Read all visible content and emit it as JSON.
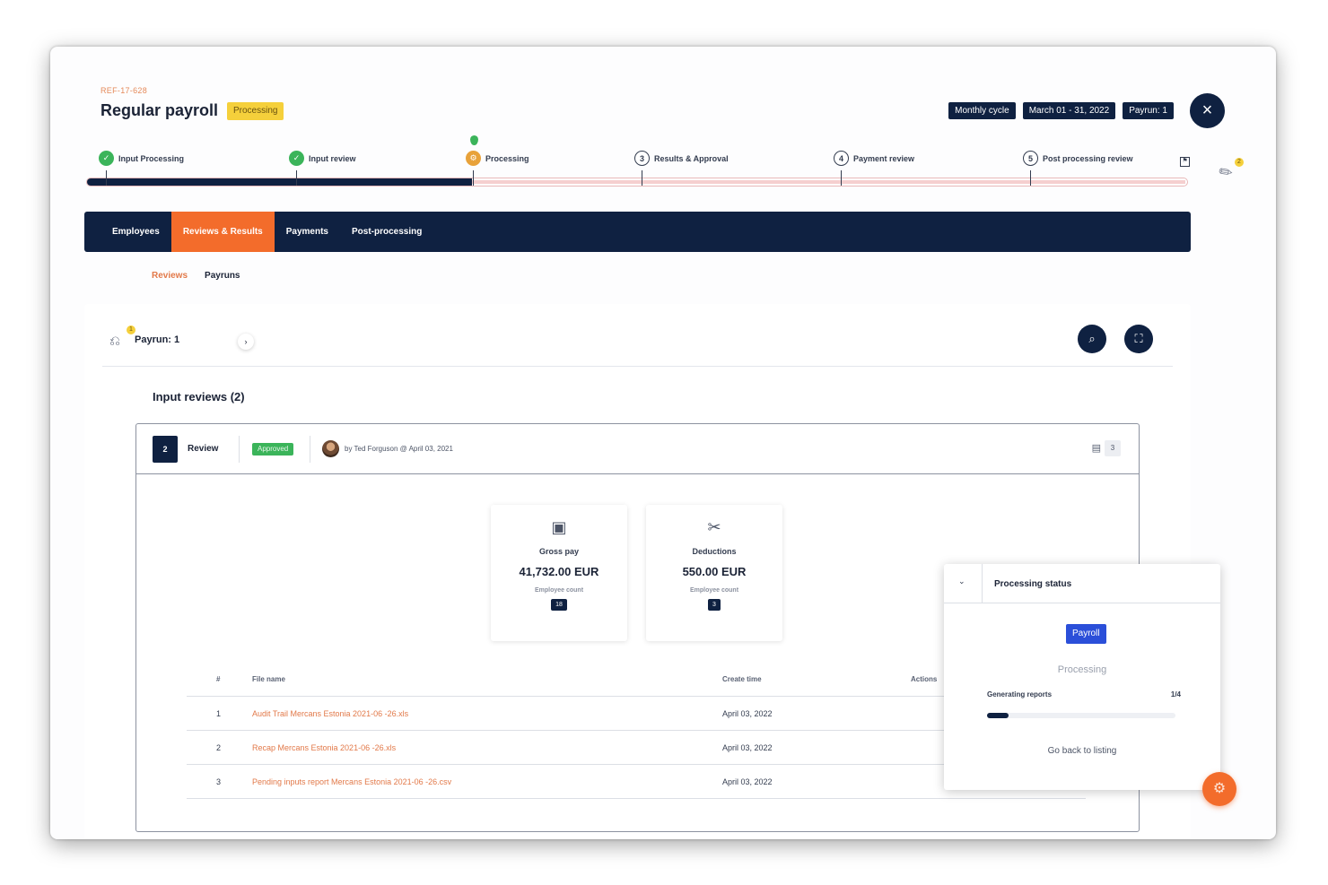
{
  "header": {
    "ref": "REF-17-628",
    "title": "Regular payroll",
    "status_badge": "Processing",
    "tags": [
      "Monthly cycle",
      "March 01 - 31, 2022",
      "Payrun: 1"
    ],
    "close_icon": "×"
  },
  "stepper": {
    "steps": [
      {
        "label": "Input Processing",
        "marker": "✓",
        "state": "done"
      },
      {
        "label": "Input review",
        "marker": "✓",
        "state": "done"
      },
      {
        "label": "Processing",
        "marker": "⚙",
        "state": "current"
      },
      {
        "label": "Results & Approval",
        "marker": "3",
        "state": "todo"
      },
      {
        "label": "Payment review",
        "marker": "4",
        "state": "todo"
      },
      {
        "label": "Post processing review",
        "marker": "5",
        "state": "todo"
      }
    ],
    "progress": 0.35,
    "attachments_count": "2"
  },
  "tabs": [
    "Employees",
    "Reviews & Results",
    "Payments",
    "Post-processing"
  ],
  "active_tab": "Reviews & Results",
  "subtabs": [
    "Reviews",
    "Payruns"
  ],
  "payrun": {
    "label": "Payrun: 1",
    "badge": "1",
    "next_icon": "›",
    "search_icon": "⌕",
    "expand_icon": "⛶"
  },
  "section_title": "Input reviews (2)",
  "review": {
    "number": "2",
    "label": "Review",
    "status": "Approved",
    "by_line": "by Ted Forguson @ April 03, 2021",
    "doc_count": "3"
  },
  "stats": [
    {
      "icon": "money-icon",
      "glyph": "▣",
      "label": "Gross pay",
      "value": "41,732.00 EUR",
      "sub": "Employee count",
      "count": "18"
    },
    {
      "icon": "deductions-icon",
      "glyph": "✂",
      "label": "Deductions",
      "value": "550.00 EUR",
      "sub": "Employee count",
      "count": "3"
    }
  ],
  "files": {
    "headers": {
      "num": "#",
      "name": "File name",
      "time": "Create time",
      "actions": "Actions"
    },
    "rows": [
      {
        "num": "1",
        "name": "Audit Trail Mercans Estonia 2021-06 -26.xls",
        "time": "April 03, 2022"
      },
      {
        "num": "2",
        "name": "Recap Mercans Estonia 2021-06 -26.xls",
        "time": "April 03, 2022"
      },
      {
        "num": "3",
        "name": "Pending inputs report Mercans Estonia 2021-06 -26.csv",
        "time": "April 03, 2022"
      }
    ]
  },
  "processing_status": {
    "title": "Processing status",
    "collapse_icon": "⌄",
    "pill": "Payroll",
    "state": "Processing",
    "task": "Generating reports",
    "fraction": "1/4",
    "progress": 0.25,
    "back_link": "Go back to listing"
  },
  "colors": {
    "navy": "#0f2141",
    "accent": "#f36c2b",
    "success": "#3bb45a",
    "warning": "#f5d03b",
    "info": "#2b4fd9"
  }
}
